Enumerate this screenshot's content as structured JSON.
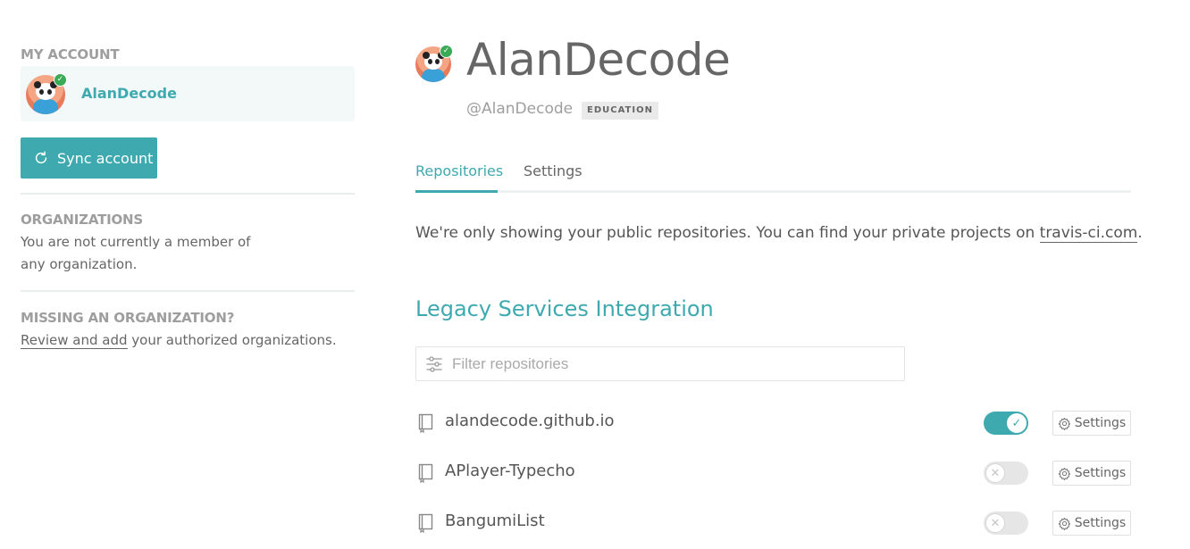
{
  "sidebar": {
    "my_account_heading": "MY ACCOUNT",
    "account_name": "AlanDecode",
    "sync_button_label": "Sync account",
    "organizations_heading": "ORGANIZATIONS",
    "organizations_text_line1": "You are not currently a member of",
    "organizations_text_line2": "any organization.",
    "missing_heading": "MISSING AN ORGANIZATION?",
    "review_link": "Review and add",
    "review_rest": " your authorized organizations."
  },
  "profile": {
    "name": "AlanDecode",
    "handle": "@AlanDecode",
    "badge": "EDUCATION"
  },
  "tabs": [
    {
      "label": "Repositories",
      "active": true
    },
    {
      "label": "Settings",
      "active": false
    }
  ],
  "notice": {
    "text": "We're only showing your public repositories. You can find your private projects on ",
    "link": "travis-ci.com",
    "end": "."
  },
  "section": {
    "title": "Legacy Services Integration"
  },
  "filter": {
    "placeholder": "Filter repositories"
  },
  "repositories": [
    {
      "name": "alandecode.github.io",
      "enabled": true,
      "settings_label": "Settings"
    },
    {
      "name": "APlayer-Typecho",
      "enabled": false,
      "settings_label": "Settings"
    },
    {
      "name": "BangumiList",
      "enabled": false,
      "settings_label": "Settings"
    }
  ],
  "colors": {
    "accent": "#3eaaaf",
    "success": "#39aa56"
  }
}
